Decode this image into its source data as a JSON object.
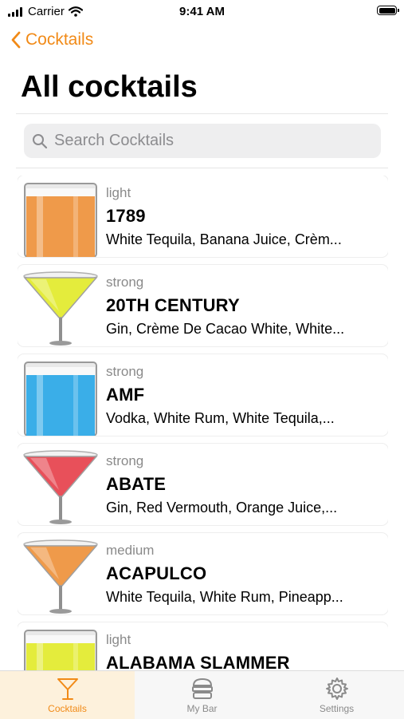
{
  "status_bar": {
    "carrier": "Carrier",
    "time": "9:41 AM"
  },
  "nav": {
    "back_label": "Cocktails",
    "title": "All cocktails"
  },
  "search": {
    "placeholder": "Search Cocktails",
    "value": ""
  },
  "cocktails": [
    {
      "strength": "light",
      "name": "1789",
      "ingredients": "White Tequila, Banana Juice, Crèm...",
      "glass": "tumbler",
      "color": "#ef9a4a"
    },
    {
      "strength": "strong",
      "name": "20TH CENTURY",
      "ingredients": "Gin, Crème De Cacao White, White...",
      "glass": "martini",
      "color": "#e4ec3c"
    },
    {
      "strength": "strong",
      "name": "AMF",
      "ingredients": "Vodka, White Rum, White Tequila,...",
      "glass": "tumbler",
      "color": "#3aaee8"
    },
    {
      "strength": "strong",
      "name": "ABATE",
      "ingredients": "Gin, Red Vermouth, Orange Juice,...",
      "glass": "martini",
      "color": "#e8505a"
    },
    {
      "strength": "medium",
      "name": "ACAPULCO",
      "ingredients": "White Tequila, White Rum, Pineapp...",
      "glass": "martini",
      "color": "#ef9a4a"
    },
    {
      "strength": "light",
      "name": "ALABAMA SLAMMER",
      "ingredients": "",
      "glass": "tumbler",
      "color": "#e4ec3c"
    }
  ],
  "tabs": [
    {
      "label": "Cocktails",
      "icon": "martini-glass-icon",
      "active": true
    },
    {
      "label": "My Bar",
      "icon": "bar-shelf-icon",
      "active": false
    },
    {
      "label": "Settings",
      "icon": "gear-icon",
      "active": false
    }
  ],
  "colors": {
    "accent": "#f18a17"
  }
}
